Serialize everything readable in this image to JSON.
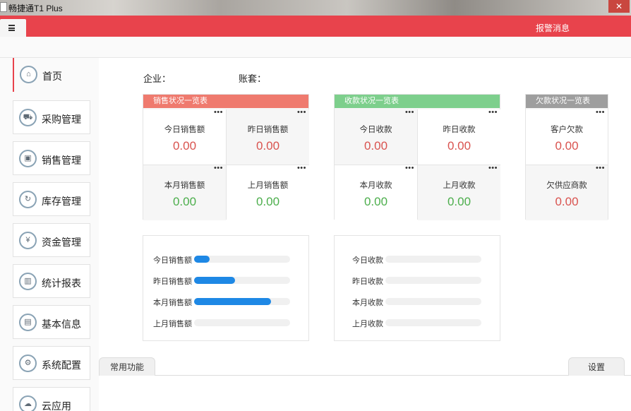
{
  "window": {
    "title": "畅捷通T1 Plus",
    "close_label": "✕"
  },
  "header": {
    "alert_msg": "报警消息"
  },
  "sidebar": {
    "items": [
      {
        "label": "首页",
        "icon": "home-icon",
        "glyph": "⌂"
      },
      {
        "label": "采购管理",
        "icon": "cart-icon",
        "glyph": "⛟"
      },
      {
        "label": "销售管理",
        "icon": "box-icon",
        "glyph": "▣"
      },
      {
        "label": "库存管理",
        "icon": "inventory-icon",
        "glyph": "↻"
      },
      {
        "label": "资金管理",
        "icon": "money-icon",
        "glyph": "¥"
      },
      {
        "label": "统计报表",
        "icon": "chart-icon",
        "glyph": "▥"
      },
      {
        "label": "基本信息",
        "icon": "document-icon",
        "glyph": "▤"
      },
      {
        "label": "系统配置",
        "icon": "gear-icon",
        "glyph": "⚙"
      },
      {
        "label": "云应用",
        "icon": "cloud-icon",
        "glyph": "☁"
      }
    ]
  },
  "info": {
    "company_label": "企业：",
    "account_label": "账套："
  },
  "sales": {
    "title": "销售状况一览表",
    "color": "#ef7a6e",
    "today_label": "今日销售额",
    "today_value": "0.00",
    "yesterday_label": "昨日销售额",
    "yesterday_value": "0.00",
    "month_label": "本月销售额",
    "month_value": "0.00",
    "lastmonth_label": "上月销售额",
    "lastmonth_value": "0.00"
  },
  "receipts": {
    "title": "收款状况一览表",
    "color": "#7dcf8c",
    "today_label": "今日收款",
    "today_value": "0.00",
    "yesterday_label": "昨日收款",
    "yesterday_value": "0.00",
    "month_label": "本月收款",
    "month_value": "0.00",
    "lastmonth_label": "上月收款",
    "lastmonth_value": "0.00"
  },
  "debts": {
    "title": "欠款状况一览表",
    "color": "#9e9e9e",
    "customer_label": "客户欠款",
    "customer_value": "0.00",
    "supplier_label": "欠供应商款",
    "supplier_value": "0.00"
  },
  "more_label": "•••",
  "sales_bars": [
    {
      "label": "今日销售额",
      "fill": 0.16
    },
    {
      "label": "昨日销售额",
      "fill": 0.43
    },
    {
      "label": "本月销售额",
      "fill": 0.8
    },
    {
      "label": "上月销售额",
      "fill": 0.0
    }
  ],
  "receipt_bars": [
    {
      "label": "今日收款",
      "fill": 0.0
    },
    {
      "label": "昨日收款",
      "fill": 0.0
    },
    {
      "label": "本月收款",
      "fill": 0.0
    },
    {
      "label": "上月收款",
      "fill": 0.0
    }
  ],
  "bottom_tabs": {
    "common": "常用功能",
    "settings": "设置"
  },
  "colors": {
    "accent": "#e8434c",
    "bar": "#1e88e5",
    "positive": "#4cae4c",
    "negative": "#d9534f"
  }
}
